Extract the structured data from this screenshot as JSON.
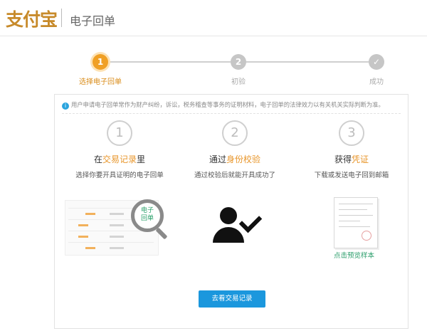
{
  "header": {
    "logo_text": "支付宝",
    "title": "电子回单"
  },
  "steps": [
    {
      "number": "1",
      "label": "选择电子回单",
      "state": "active"
    },
    {
      "number": "2",
      "label": "初验",
      "state": "inactive"
    },
    {
      "number": "✓",
      "label": "成功",
      "state": "inactive"
    }
  ],
  "notice": {
    "icon": "info-icon",
    "text": "用户申请电子回单常作为财产纠纷，诉讼，税务稽查等事务的证明材料，电子回单的法律效力以有关机关实际判断为准。"
  },
  "columns": [
    {
      "number": "1",
      "title_pre": "在",
      "title_hl": "交易记录",
      "title_post": "里",
      "desc": "选择你要开具证明的电子回单"
    },
    {
      "number": "2",
      "title_pre": "通过",
      "title_hl": "身份校验",
      "title_post": "",
      "desc": "通过校验后就能开具成功了"
    },
    {
      "number": "3",
      "title_pre": "获得",
      "title_hl": "凭证",
      "title_post": "",
      "desc": "下载或发送电子回到邮箱"
    }
  ],
  "magnifier_text": {
    "line1": "电子",
    "line2": "回单"
  },
  "preview_link": "点击预览样本",
  "primary_button": "去看交易记录",
  "colors": {
    "accent": "#f0a025",
    "primary": "#1b97dd",
    "link": "#2a9d6a"
  }
}
